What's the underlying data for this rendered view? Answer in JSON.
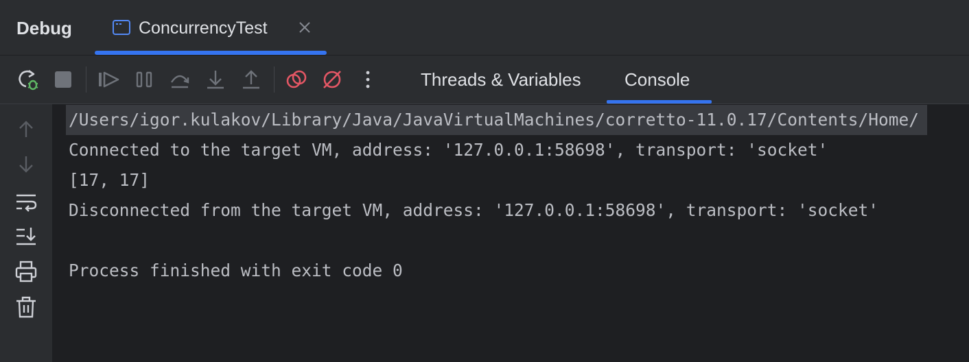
{
  "topbar": {
    "title": "Debug",
    "tab": {
      "title": "ConcurrencyTest",
      "icon": "console-app-icon"
    },
    "close_icon": "close-icon"
  },
  "toolbar": {
    "buttons": [
      {
        "name": "rerun-debug",
        "icon": "rerun-bug-icon"
      },
      {
        "name": "stop",
        "icon": "stop-icon"
      },
      {
        "name": "resume",
        "icon": "resume-icon"
      },
      {
        "name": "pause",
        "icon": "pause-icon"
      },
      {
        "name": "step-over",
        "icon": "step-over-icon"
      },
      {
        "name": "step-into",
        "icon": "step-into-icon"
      },
      {
        "name": "step-out",
        "icon": "step-out-icon"
      },
      {
        "name": "view-breakpoints",
        "icon": "breakpoints-icon"
      },
      {
        "name": "mute-breakpoints",
        "icon": "mute-breakpoints-icon"
      },
      {
        "name": "more",
        "icon": "more-vertical-icon"
      }
    ],
    "tabs": [
      {
        "label": "Threads & Variables",
        "active": false
      },
      {
        "label": "Console",
        "active": true
      }
    ]
  },
  "gutter": {
    "buttons": [
      {
        "name": "up-stack",
        "icon": "arrow-up-icon"
      },
      {
        "name": "down-stack",
        "icon": "arrow-down-icon"
      },
      {
        "name": "soft-wrap",
        "icon": "soft-wrap-icon"
      },
      {
        "name": "scroll-to-end",
        "icon": "scroll-to-end-icon"
      },
      {
        "name": "print",
        "icon": "printer-icon"
      },
      {
        "name": "clear-all",
        "icon": "trash-icon"
      }
    ]
  },
  "console": {
    "lines": [
      "/Users/igor.kulakov/Library/Java/JavaVirtualMachines/corretto-11.0.17/Contents/Home/",
      "Connected to the target VM, address: '127.0.0.1:58698', transport: 'socket'",
      "[17, 17]",
      "Disconnected from the target VM, address: '127.0.0.1:58698', transport: 'socket'",
      "",
      "Process finished with exit code 0"
    ]
  },
  "colors": {
    "accent": "#3574f0",
    "red_icon": "#e55765",
    "green_icon": "#5fb865",
    "icon_gray": "#ced0d6",
    "disabled_gray": "#6f737a"
  }
}
